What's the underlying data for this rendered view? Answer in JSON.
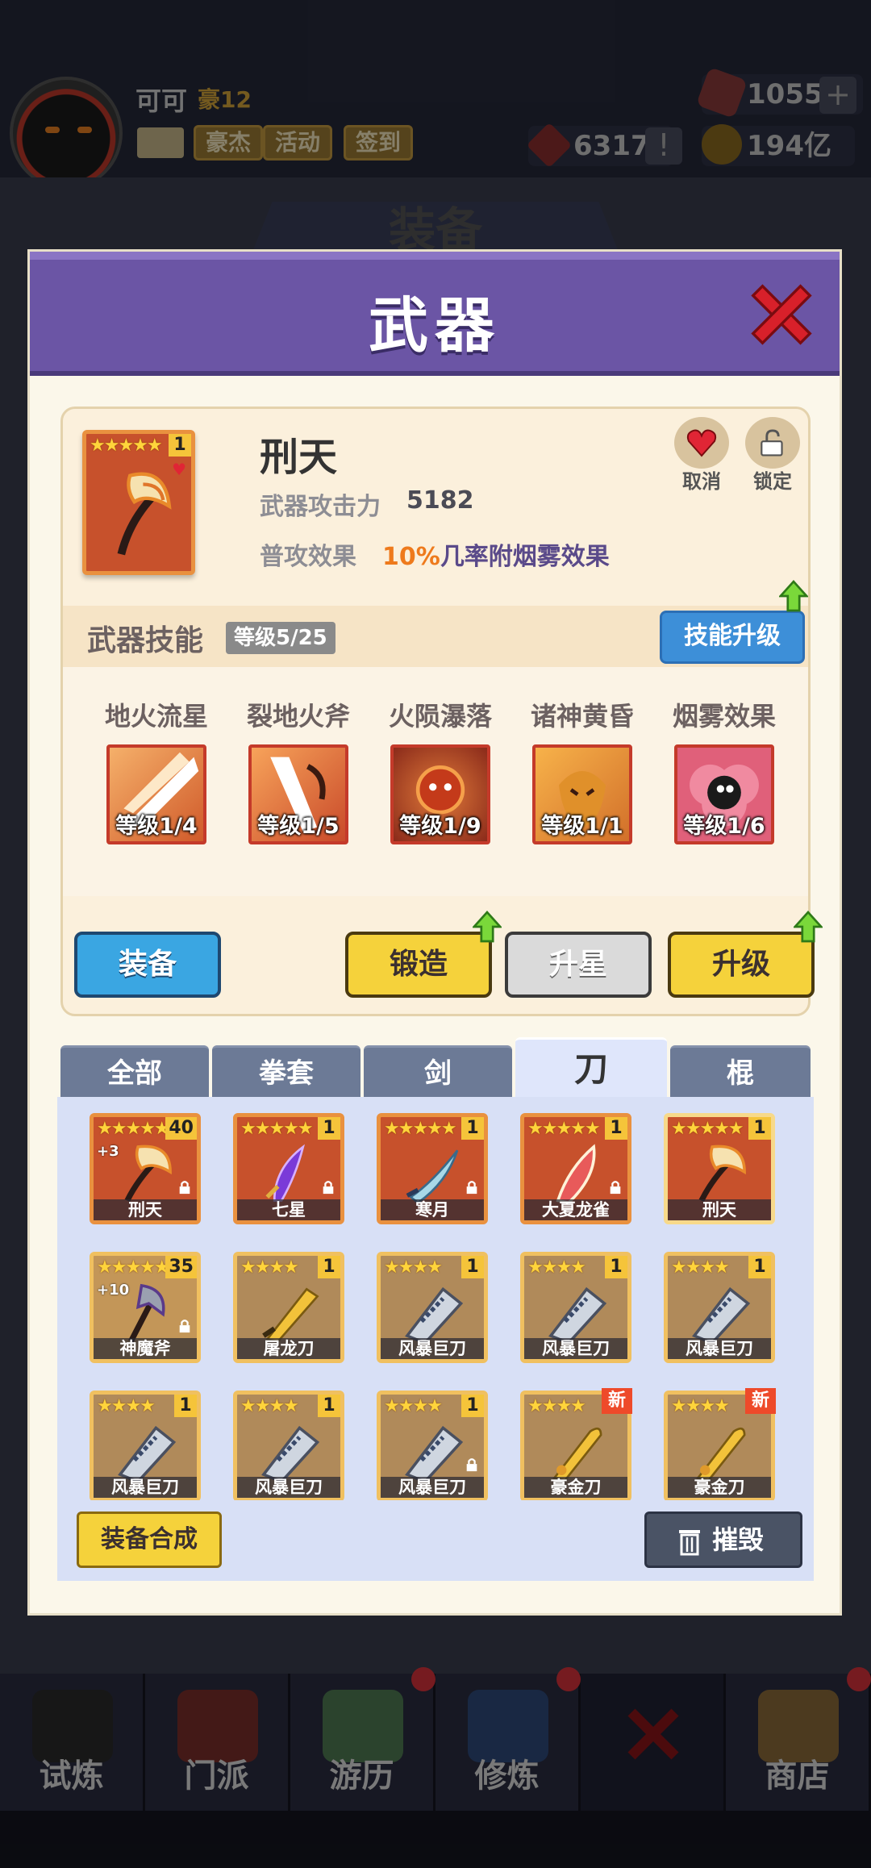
{
  "player": {
    "name": "可可",
    "rank": "豪12",
    "buttons": [
      "豪杰",
      "活动",
      "签到"
    ]
  },
  "resources": {
    "gems": "1055",
    "tokens": "6317",
    "gold": "194亿",
    "plus_label": "+",
    "alert_label": "!"
  },
  "background_title": "装备",
  "modal": {
    "title": "武器"
  },
  "weapon": {
    "stars": "★★★★★",
    "count": "1",
    "name": "刑天",
    "attack_label": "武器攻击力",
    "attack_value": "5182",
    "effect_label": "普攻效果",
    "effect_pct": "10%",
    "effect_text": "几率附烟雾效果",
    "cancel_label": "取消",
    "lock_label": "锁定"
  },
  "skills": {
    "title": "武器技能",
    "level_badge": "等级5/25",
    "upgrade_label": "技能升级",
    "items": [
      {
        "name": "地火流星",
        "level": "等级1/4"
      },
      {
        "name": "裂地火斧",
        "level": "等级1/5"
      },
      {
        "name": "火陨瀑落",
        "level": "等级1/9"
      },
      {
        "name": "诸神黄昏",
        "level": "等级1/1"
      },
      {
        "name": "烟雾效果",
        "level": "等级1/6"
      }
    ]
  },
  "actions": {
    "equip": "装备",
    "forge": "锻造",
    "star_up": "升星",
    "upgrade": "升级"
  },
  "tabs": [
    "全部",
    "拳套",
    "剑",
    "刀",
    "棍"
  ],
  "inventory": [
    {
      "name": "刑天",
      "stars": "★★★★★",
      "count": "40",
      "plus": "+3"
    },
    {
      "name": "七星",
      "stars": "★★★★★",
      "count": "1",
      "plus": ""
    },
    {
      "name": "寒月",
      "stars": "★★★★★",
      "count": "1",
      "plus": ""
    },
    {
      "name": "大夏龙雀",
      "stars": "★★★★★",
      "count": "1",
      "plus": ""
    },
    {
      "name": "刑天",
      "stars": "★★★★★",
      "count": "1",
      "plus": ""
    },
    {
      "name": "神魔斧",
      "stars": "★★★★★",
      "count": "35",
      "plus": "+10"
    },
    {
      "name": "屠龙刀",
      "stars": "★★★★",
      "count": "1",
      "plus": ""
    },
    {
      "name": "风暴巨刀",
      "stars": "★★★★",
      "count": "1",
      "plus": ""
    },
    {
      "name": "风暴巨刀",
      "stars": "★★★★",
      "count": "1",
      "plus": ""
    },
    {
      "name": "风暴巨刀",
      "stars": "★★★★",
      "count": "1",
      "plus": ""
    },
    {
      "name": "风暴巨刀",
      "stars": "★★★★",
      "count": "1",
      "plus": ""
    },
    {
      "name": "风暴巨刀",
      "stars": "★★★★",
      "count": "1",
      "plus": ""
    },
    {
      "name": "风暴巨刀",
      "stars": "★★★★",
      "count": "1",
      "plus": ""
    },
    {
      "name": "豪金刀",
      "stars": "★★★★",
      "count": "",
      "plus": "",
      "badge": "新"
    },
    {
      "name": "豪金刀",
      "stars": "★★★★",
      "count": "",
      "plus": "",
      "badge": "新"
    }
  ],
  "footer": {
    "synth": "装备合成",
    "destroy": "摧毁"
  },
  "bottom_nav": [
    "试炼",
    "门派",
    "游历",
    "修炼",
    "",
    "商店"
  ],
  "colors": {
    "header_purple": "#6b55a5",
    "accent_orange": "#ee7a1c",
    "button_blue": "#3aa6e2",
    "button_yellow": "#f5d23b",
    "close_red": "#d8202a"
  }
}
